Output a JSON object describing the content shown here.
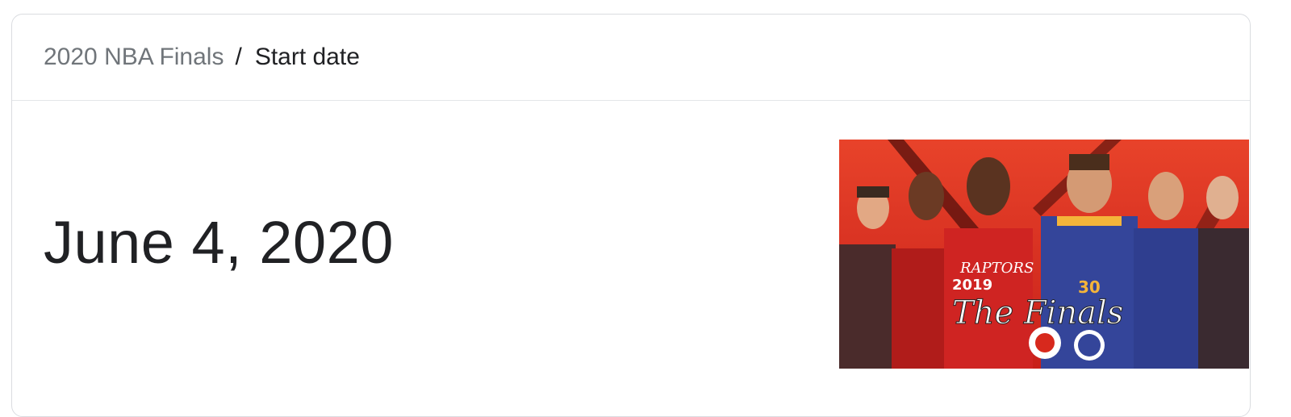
{
  "breadcrumb": {
    "parent": "2020 NBA Finals",
    "separator": "/",
    "current": "Start date"
  },
  "answer": {
    "value": "June 4, 2020"
  },
  "image": {
    "logo_year": "2019",
    "logo_text": "The Finals",
    "jersey_text": "RAPTORS",
    "jersey_number": "30"
  },
  "colors": {
    "card_border": "#dadce0",
    "breadcrumb_link": "#70757a",
    "text_primary": "#202124",
    "poster_red": "#d7291d",
    "warriors_blue": "#34459a",
    "warriors_gold": "#f4b43a"
  }
}
